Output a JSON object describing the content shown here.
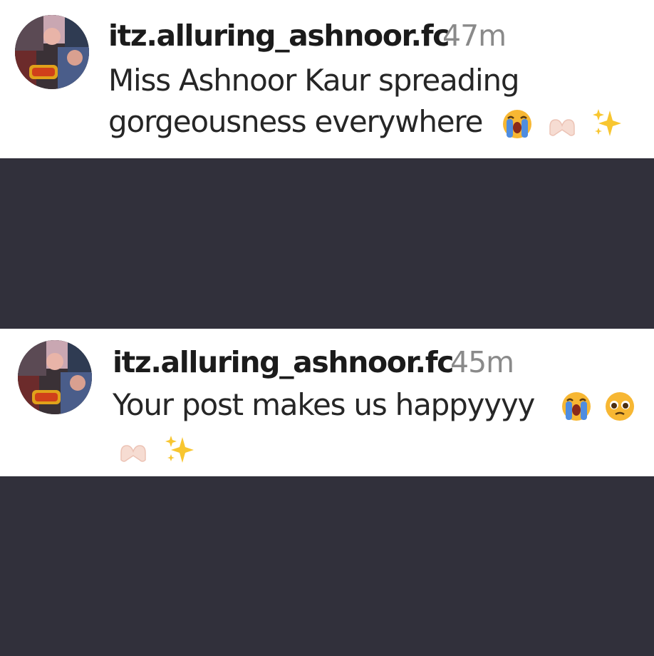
{
  "comments": [
    {
      "username": "itz.alluring_ashnoor.fc",
      "time": "47m",
      "lines": [
        "Miss Ashnoor Kaur spreading",
        "gorgeousness everywhere"
      ],
      "emojis": [
        "loudly-crying-face",
        "heart-hands",
        "sparkles"
      ]
    },
    {
      "username": "itz.alluring_ashnoor.fc",
      "time": "45m",
      "lines": [
        "Your post makes us happyyyy"
      ],
      "emojis": [
        "loudly-crying-face",
        "pleading-face",
        "heart-hands",
        "sparkles"
      ]
    }
  ],
  "colors": {
    "background_dark": "#31303b",
    "comment_bg": "#ffffff",
    "username": "#1b1b1b",
    "timestamp": "#8a8a8a",
    "body_text": "#262626"
  }
}
